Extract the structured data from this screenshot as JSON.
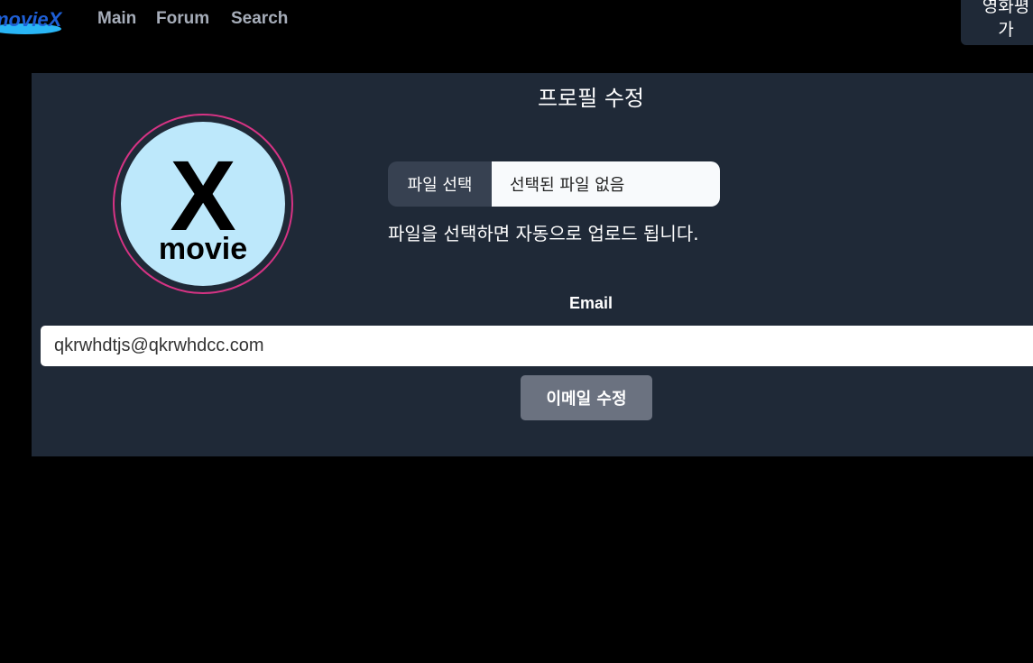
{
  "header": {
    "logo_text": "movieX",
    "nav": [
      "Main",
      "Forum",
      "Search"
    ],
    "rate_button": {
      "line1": "영화평",
      "line2": "가"
    }
  },
  "profile": {
    "title": "프로필 수정",
    "avatar": {
      "logo_letter": "X",
      "logo_word": "movie"
    },
    "file": {
      "button_label": "파일 선택",
      "no_file_label": "선택된 파일 없음",
      "hint": "파일을 선택하면 자동으로 업로드 됩니다."
    },
    "email": {
      "label": "Email",
      "value": "qkrwhdtjs@qkrwhdcc.com",
      "button_label": "이메일 수정"
    }
  },
  "colors": {
    "page_bg": "#000000",
    "card_bg": "#1f2937",
    "nav_text": "#a6adb9",
    "avatar_ring": "#d63384",
    "avatar_bg": "#bde8fb",
    "logo_blue": "#1e5fd6",
    "button_gray": "#6b7280"
  }
}
